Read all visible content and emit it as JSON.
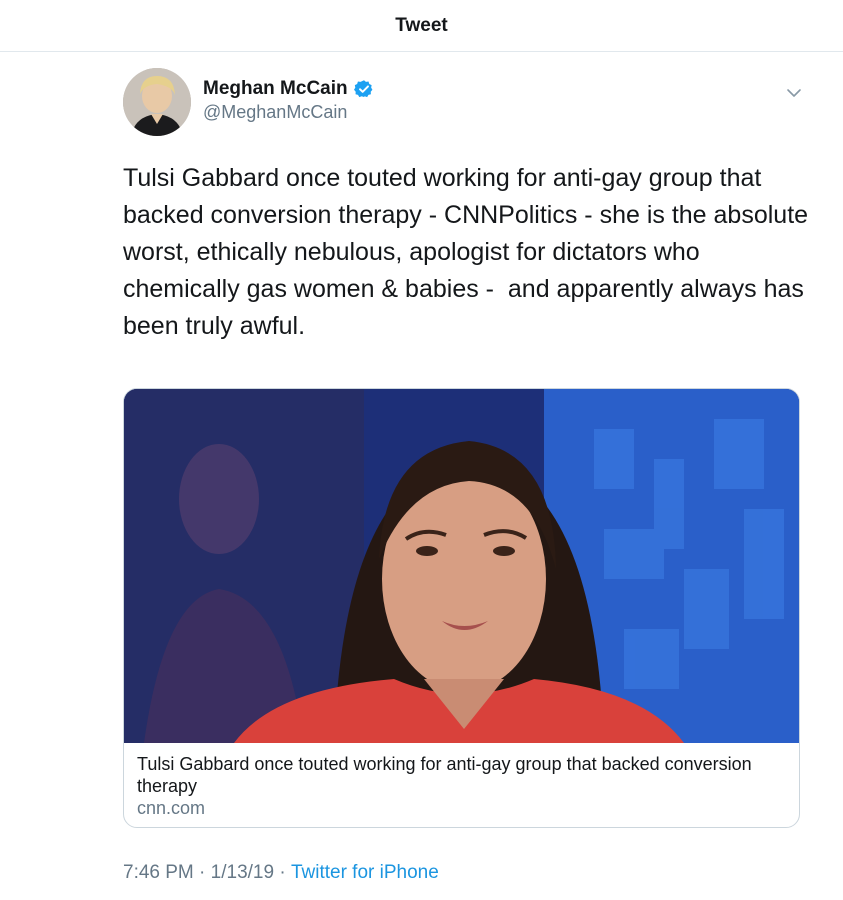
{
  "header": {
    "title": "Tweet"
  },
  "author": {
    "name": "Meghan McCain",
    "handle": "@MeghanMcCain",
    "verified": true
  },
  "tweet": {
    "text": "Tulsi Gabbard once touted working for anti-gay group that backed conversion therapy - CNNPolitics - she is the absolute worst, ethically nebulous, apologist for dictators who chemically gas women & babies -  and apparently always has been truly awful."
  },
  "card": {
    "title": "Tulsi Gabbard once touted working for anti-gay group that backed conversion therapy",
    "domain": "cnn.com"
  },
  "meta": {
    "time": "7:46 PM",
    "separator": " · ",
    "date": "1/13/19",
    "separator2": " · ",
    "source": "Twitter for iPhone"
  },
  "colors": {
    "link": "#1b95e0",
    "verified": "#1da1f2",
    "secondary_text": "#657786",
    "border": "#e1e8ed"
  },
  "icons": [
    "verified-badge-icon",
    "chevron-down-icon"
  ]
}
